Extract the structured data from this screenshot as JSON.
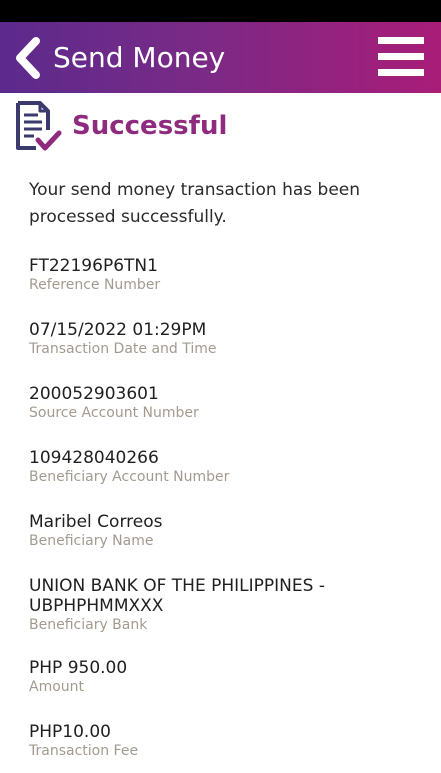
{
  "header": {
    "title": "Send Money",
    "back_icon": "chevron-left-icon",
    "menu_icon": "hamburger-menu-icon",
    "gradient_start": "#5b2a8c",
    "gradient_end": "#a81d78"
  },
  "status": {
    "icon": "receipt-check-icon",
    "title": "Successful",
    "accent_color": "#8e2b7e"
  },
  "message": "Your send money transaction has been processed successfully.",
  "details": [
    {
      "value": "FT22196P6TN1",
      "label": "Reference Number"
    },
    {
      "value": "07/15/2022 01:29PM",
      "label": "Transaction Date and Time"
    },
    {
      "value": "200052903601",
      "label": "Source Account Number"
    },
    {
      "value": "109428040266",
      "label": "Beneficiary Account Number"
    },
    {
      "value": "Maribel Correos",
      "label": "Beneficiary Name"
    },
    {
      "value": "UNION BANK OF THE PHILIPPINES -\nUBPHPHMMXXX",
      "label": "Beneficiary Bank"
    },
    {
      "value": "PHP 950.00",
      "label": "Amount"
    },
    {
      "value": "PHP10.00",
      "label": "Transaction Fee"
    }
  ]
}
